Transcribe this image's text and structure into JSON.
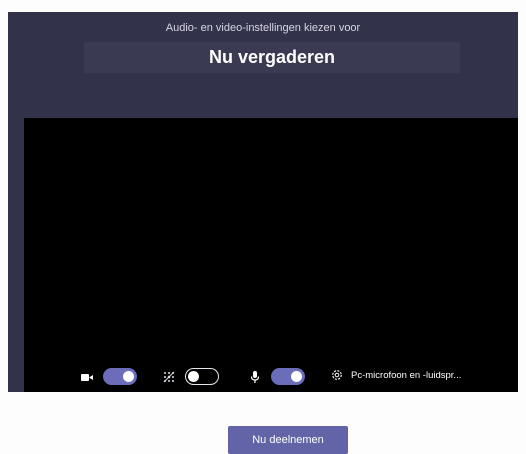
{
  "header": {
    "subtitle": "Audio- en video-instellingen kiezen voor",
    "title": "Nu vergaderen"
  },
  "join_button_label": "Nu deelnemen",
  "controls": {
    "camera": {
      "icon": "camera-icon",
      "on": true
    },
    "background_blur": {
      "icon": "background-blur-icon",
      "on": false
    },
    "microphone": {
      "icon": "microphone-icon",
      "on": true
    },
    "device_settings": {
      "icon": "gear-icon",
      "label": "Pc-microfoon en -luidspr..."
    }
  },
  "colors": {
    "background": "#32324a",
    "accent": "#6264a7",
    "preview": "#000000"
  }
}
